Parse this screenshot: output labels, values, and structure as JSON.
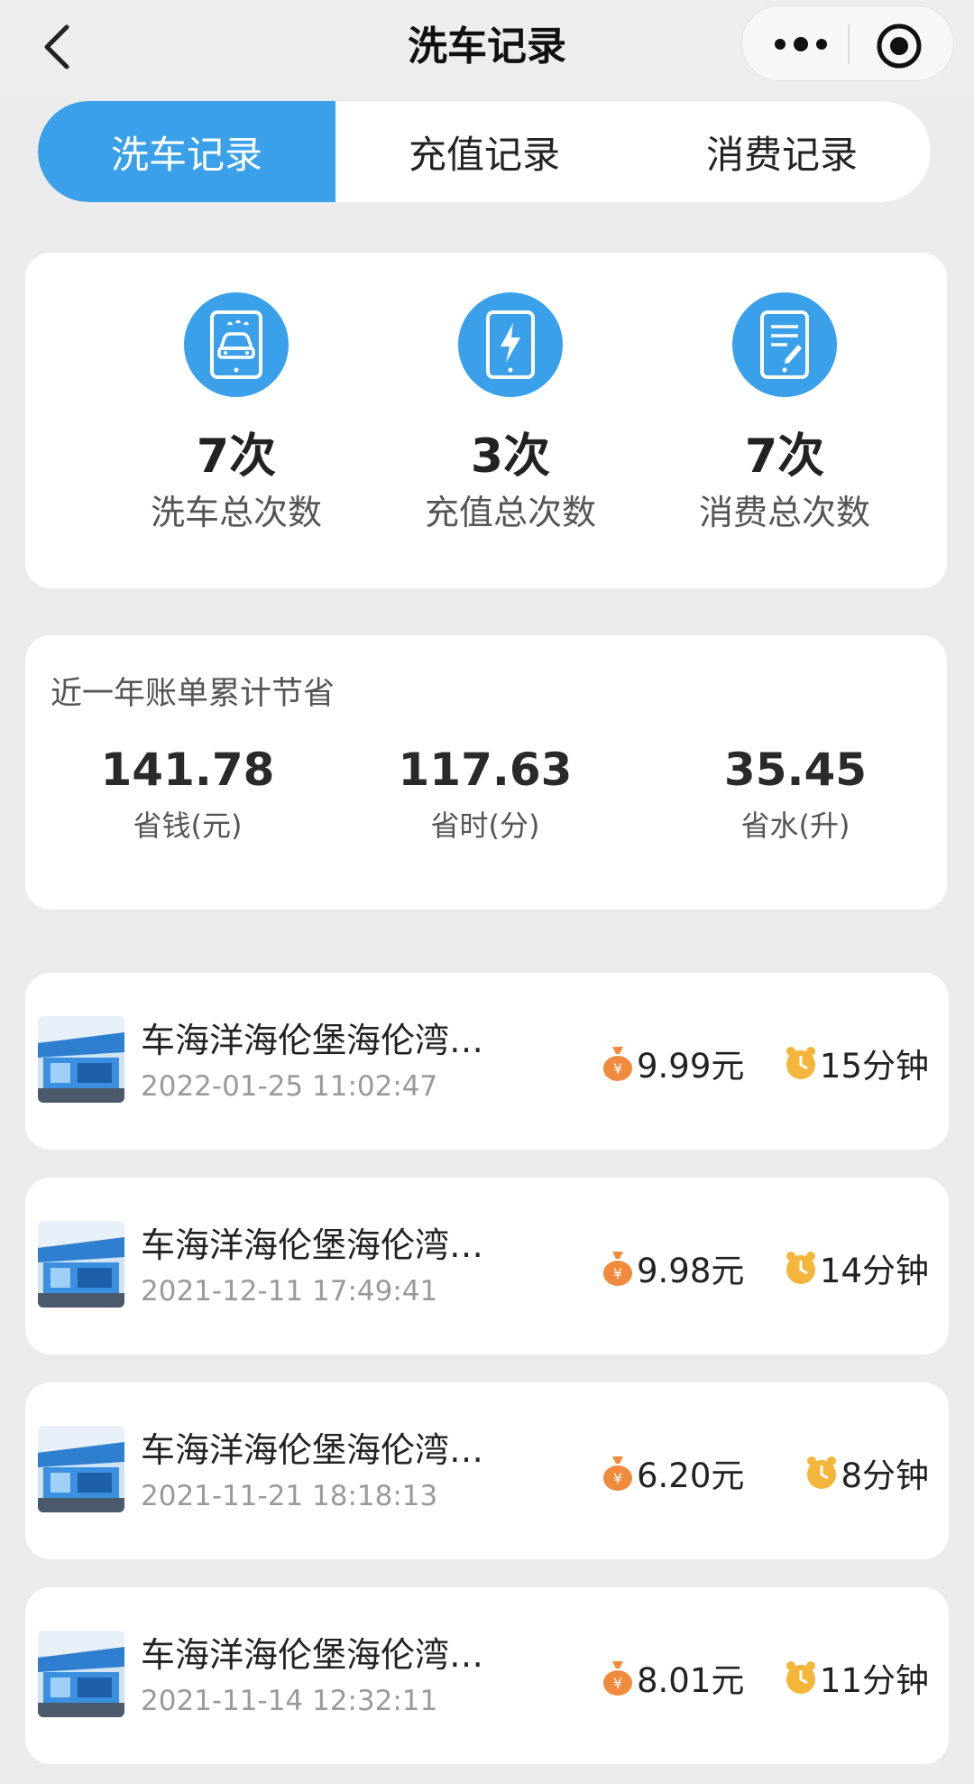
{
  "navbar": {
    "title": "洗车记录",
    "back_icon": "chevron-left-icon",
    "more_icon": "more-dots-icon",
    "close_icon": "target-circle-icon"
  },
  "tabs": [
    {
      "label": "洗车记录",
      "active": true
    },
    {
      "label": "充值记录",
      "active": false
    },
    {
      "label": "消费记录",
      "active": false
    }
  ],
  "stats": [
    {
      "icon": "car-tablet-icon",
      "value": "7次",
      "label": "洗车总次数"
    },
    {
      "icon": "charge-tablet-icon",
      "value": "3次",
      "label": "充值总次数"
    },
    {
      "icon": "notepad-tablet-icon",
      "value": "7次",
      "label": "消费总次数"
    }
  ],
  "savings": {
    "title": "近一年账单累计节省",
    "items": [
      {
        "value": "141.78",
        "label": "省钱(元)"
      },
      {
        "value": "117.63",
        "label": "省时(分)"
      },
      {
        "value": "35.45",
        "label": "省水(升)"
      }
    ]
  },
  "records": [
    {
      "name": "车海洋海伦堡海伦湾…",
      "time": "2022-01-25 11:02:47",
      "price": "9.99元",
      "duration": "15分钟"
    },
    {
      "name": "车海洋海伦堡海伦湾…",
      "time": "2021-12-11 17:49:41",
      "price": "9.98元",
      "duration": "14分钟"
    },
    {
      "name": "车海洋海伦堡海伦湾…",
      "time": "2021-11-21 18:18:13",
      "price": "6.20元",
      "duration": "8分钟"
    },
    {
      "name": "车海洋海伦堡海伦湾…",
      "time": "2021-11-14 12:32:11",
      "price": "8.01元",
      "duration": "11分钟"
    }
  ],
  "colors": {
    "accent": "#3ba0ea",
    "money_bag": "#f08a3c",
    "clock": "#f3b63a"
  }
}
